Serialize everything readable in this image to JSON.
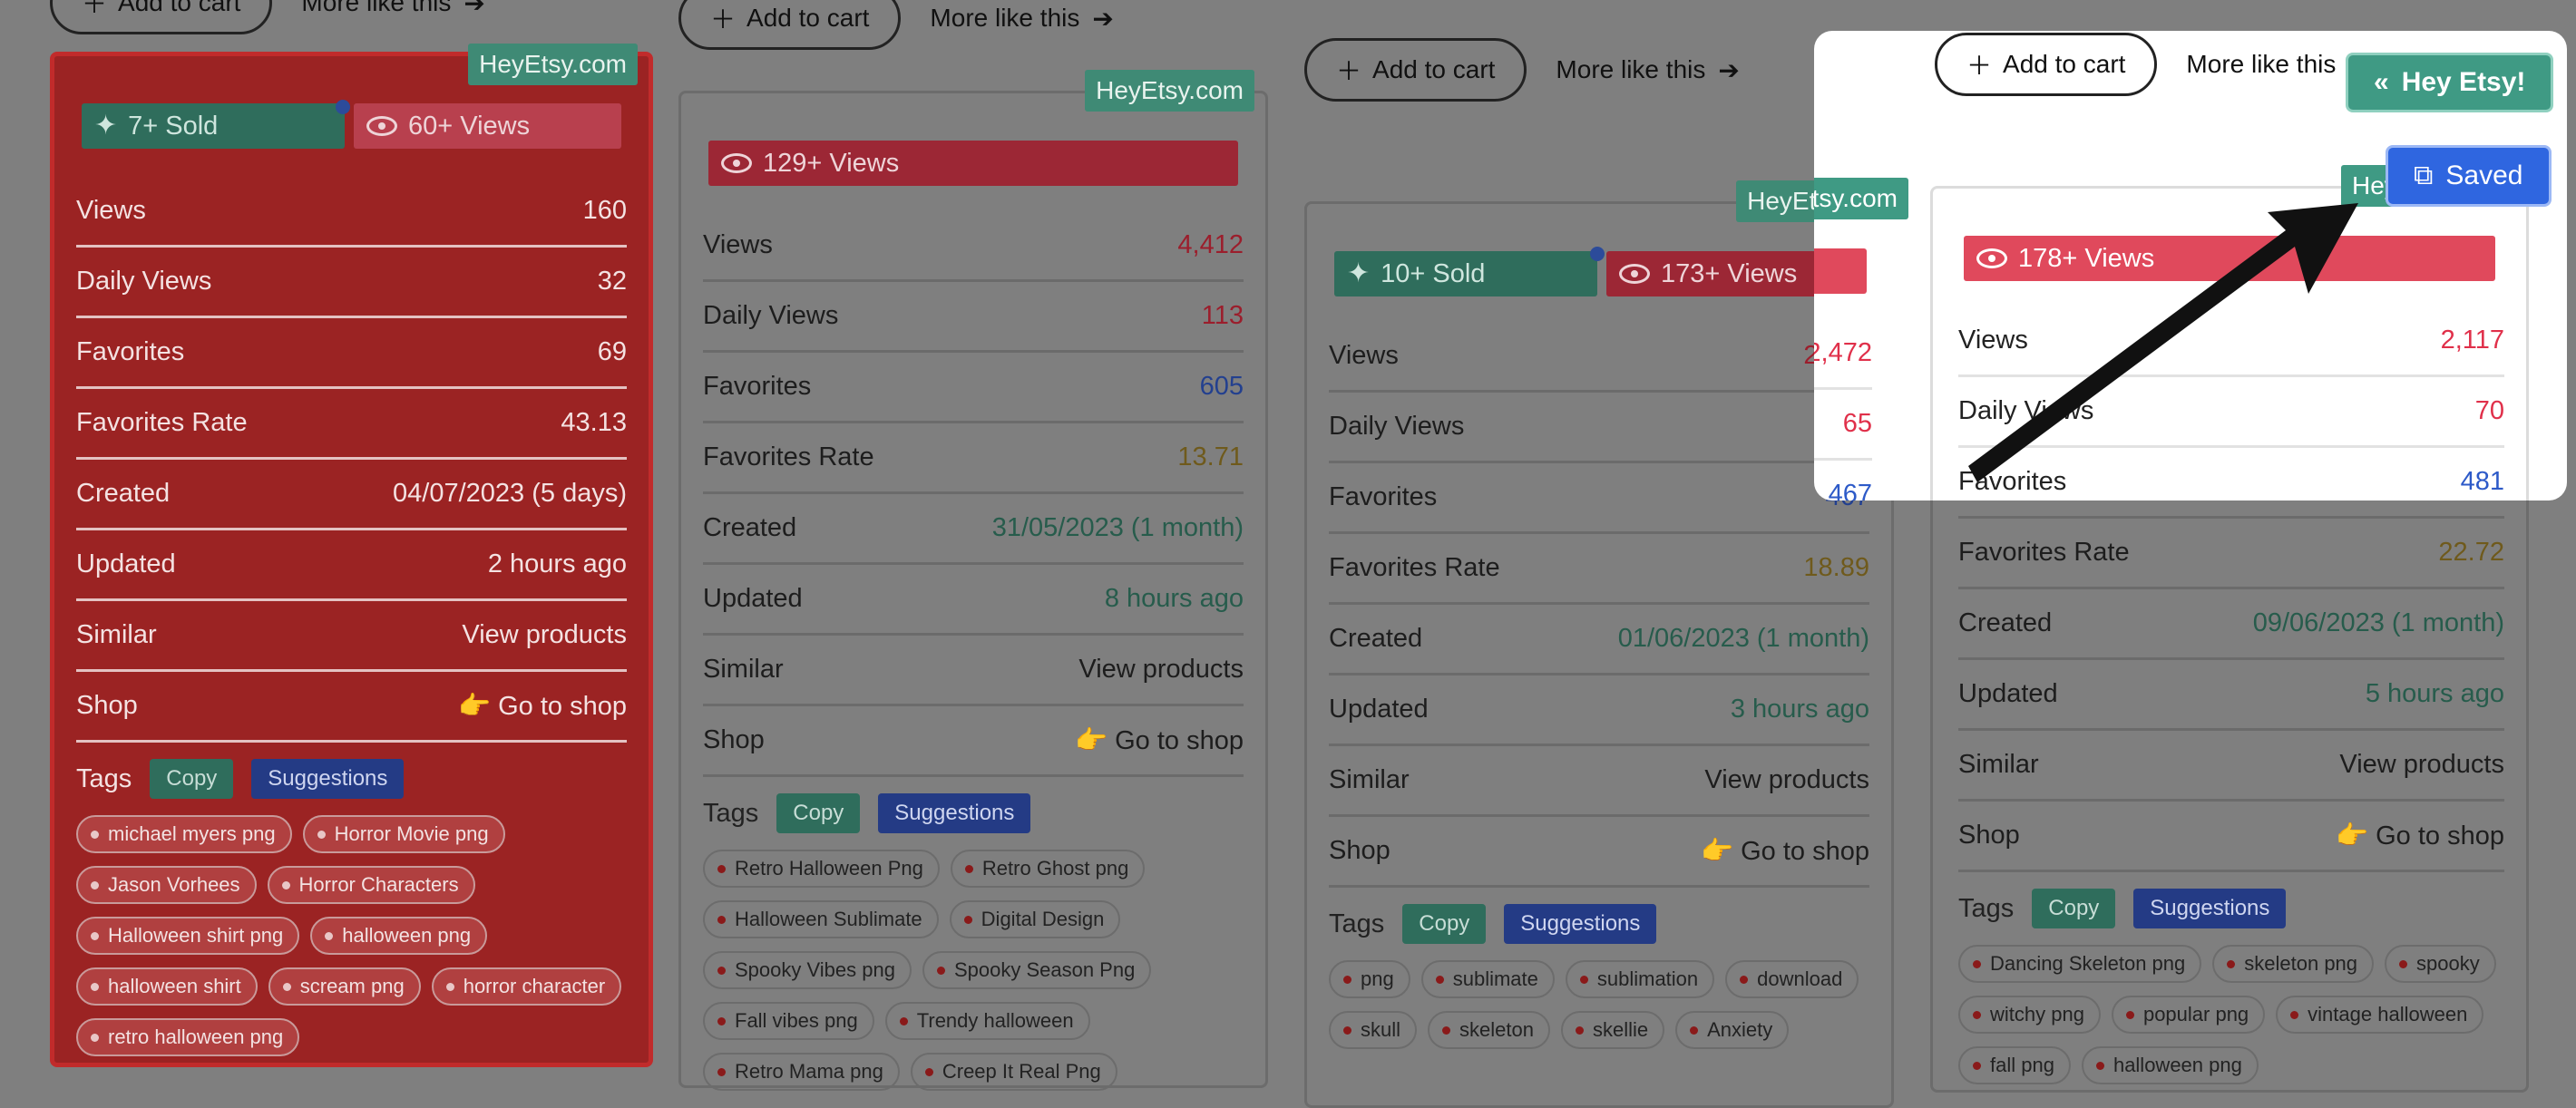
{
  "topbar": {
    "add_to_cart": "Add to cart",
    "more_like_this": "More like this"
  },
  "badge_text": "HeyEtsy.com",
  "hey_button": "Hey Etsy!",
  "saved_button": "Saved",
  "labels": {
    "views": "Views",
    "daily_views": "Daily Views",
    "favorites": "Favorites",
    "favorites_rate": "Favorites Rate",
    "created": "Created",
    "updated": "Updated",
    "similar": "Similar",
    "shop": "Shop",
    "tags": "Tags",
    "copy": "Copy",
    "suggestions": "Suggestions",
    "view_products": "View products",
    "go_to_shop": "👉 Go to shop"
  },
  "cards": [
    {
      "sold": "7+ Sold",
      "views_pill": "60+ Views",
      "views": "160",
      "daily_views": "32",
      "favorites": "69",
      "favorites_rate": "43.13",
      "created": "04/07/2023 (5 days)",
      "updated": "2 hours ago",
      "tags": [
        "michael myers png",
        "Horror Movie png",
        "Jason Vorhees",
        "Horror Characters",
        "Halloween shirt png",
        "halloween png",
        "halloween shirt",
        "scream png",
        "horror character",
        "retro halloween png"
      ]
    },
    {
      "sold": "",
      "views_pill": "129+ Views",
      "views": "4,412",
      "daily_views": "113",
      "favorites": "605",
      "favorites_rate": "13.71",
      "created": "31/05/2023 (1 month)",
      "updated": "8 hours ago",
      "tags": [
        "Retro Halloween Png",
        "Retro Ghost png",
        "Halloween Sublimate",
        "Digital Design",
        "Spooky Vibes png",
        "Spooky Season Png",
        "Fall vibes png",
        "Trendy halloween",
        "Retro Mama png",
        "Creep It Real Png"
      ]
    },
    {
      "sold": "10+ Sold",
      "views_pill": "173+ Views",
      "views": "2,472",
      "daily_views": "65",
      "favorites": "467",
      "favorites_rate": "18.89",
      "created": "01/06/2023 (1 month)",
      "updated": "3 hours ago",
      "tags": [
        "png",
        "sublimate",
        "sublimation",
        "download",
        "skull",
        "skeleton",
        "skellie",
        "Anxiety"
      ]
    },
    {
      "sold": "",
      "views_pill": "178+ Views",
      "views": "2,117",
      "daily_views": "70",
      "favorites": "481",
      "favorites_rate": "22.72",
      "created": "09/06/2023 (1 month)",
      "updated": "5 hours ago",
      "tags": [
        "Dancing Skeleton png",
        "skeleton png",
        "spooky",
        "witchy png",
        "popular png",
        "vintage halloween",
        "fall png",
        "halloween png"
      ]
    }
  ]
}
